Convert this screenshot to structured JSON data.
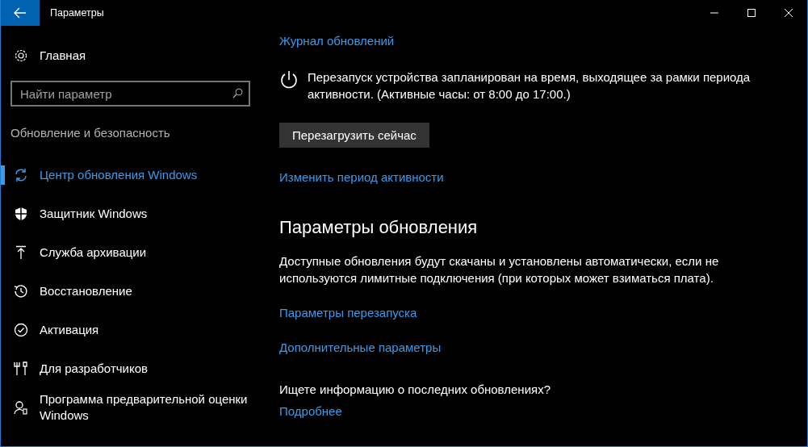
{
  "window": {
    "title": "Параметры"
  },
  "sidebar": {
    "home": "Главная",
    "search": {
      "placeholder": "Найти параметр"
    },
    "section": "Обновление и безопасность",
    "items": [
      {
        "label": "Центр обновления Windows",
        "selected": true
      },
      {
        "label": "Защитник Windows",
        "selected": false
      },
      {
        "label": "Служба архивации",
        "selected": false
      },
      {
        "label": "Восстановление",
        "selected": false
      },
      {
        "label": "Активация",
        "selected": false
      },
      {
        "label": "Для разработчиков",
        "selected": false
      },
      {
        "label": "Программа предварительной оценки Windows",
        "selected": false
      }
    ]
  },
  "content": {
    "history_link": "Журнал обновлений",
    "restart_notice": "Перезапуск устройства запланирован на время, выходящее за рамки периода активности. (Активные часы: от 8:00 до 17:00.)",
    "restart_button": "Перезагрузить сейчас",
    "active_hours_link": "Изменить период активности",
    "settings_heading": "Параметры обновления",
    "settings_text": "Доступные обновления будут скачаны и установлены автоматически, если не используются лимитные подключения (при которых может взиматься плата).",
    "settings_links": [
      "Параметры перезапуска",
      "Дополнительные параметры"
    ],
    "info_question": "Ищете информацию о последних обновлениях?",
    "info_link": "Подробнее"
  }
}
